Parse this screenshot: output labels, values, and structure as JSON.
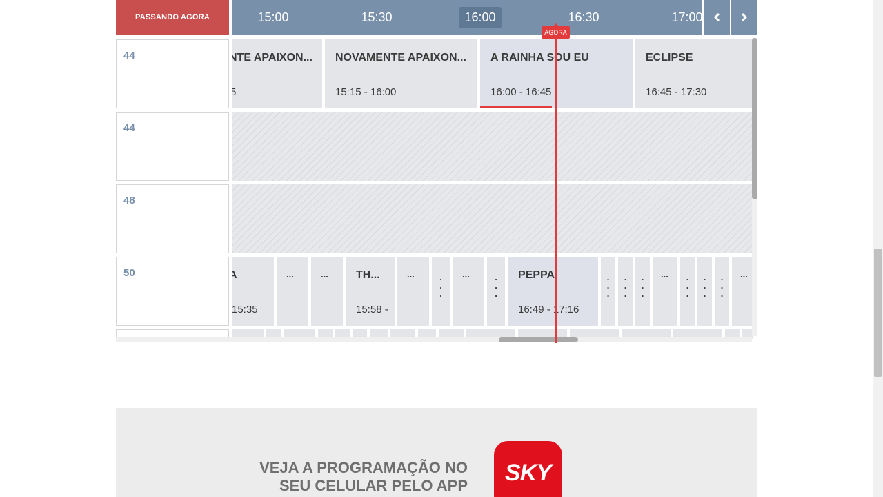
{
  "header": {
    "now_label": "PASSANDO AGORA",
    "times": [
      "15:00",
      "15:30",
      "16:00",
      "16:30",
      "17:00"
    ],
    "active_time": "16:00",
    "prev_icon": "chevron-left-icon",
    "next_icon": "chevron-right-icon"
  },
  "now_marker": {
    "label": "AGORA"
  },
  "channels": [
    {
      "number": "44",
      "programs": [
        {
          "title": "NTE APAIXON...",
          "time": "5"
        },
        {
          "title": "NOVAMENTE APAIXON...",
          "time": "15:15 - 16:00"
        },
        {
          "title": "A RAINHA SOU EU",
          "time": "16:00 - 16:45",
          "progress": 0.47
        },
        {
          "title": "ECLIPSE",
          "time": "16:45 - 17:30"
        }
      ]
    },
    {
      "number": "44",
      "programs": []
    },
    {
      "number": "48",
      "programs": []
    },
    {
      "number": "50",
      "programs": [
        {
          "title": "A",
          "time": "15:35"
        },
        {
          "title": "...",
          "time": ""
        },
        {
          "title": "...",
          "time": ""
        },
        {
          "title": "TH...",
          "time": "15:58 -"
        },
        {
          "title": "...",
          "time": ""
        },
        {
          "title": "...",
          "time": ""
        },
        {
          "title": "PEPPA",
          "time": "16:49 - 17:16"
        },
        {
          "title": "...",
          "time": ""
        },
        {
          "title": "...",
          "time": ""
        }
      ]
    }
  ],
  "promo": {
    "line1": "VEJA A PROGRAMAÇÃO NO",
    "line2": "SEU CELULAR PELO APP",
    "logo": "SKY"
  },
  "colors": {
    "accent_red": "#e33b3b",
    "header_blue": "#7990ab",
    "now_label_bg": "#c94f4f",
    "sky_red": "#e0101c"
  }
}
